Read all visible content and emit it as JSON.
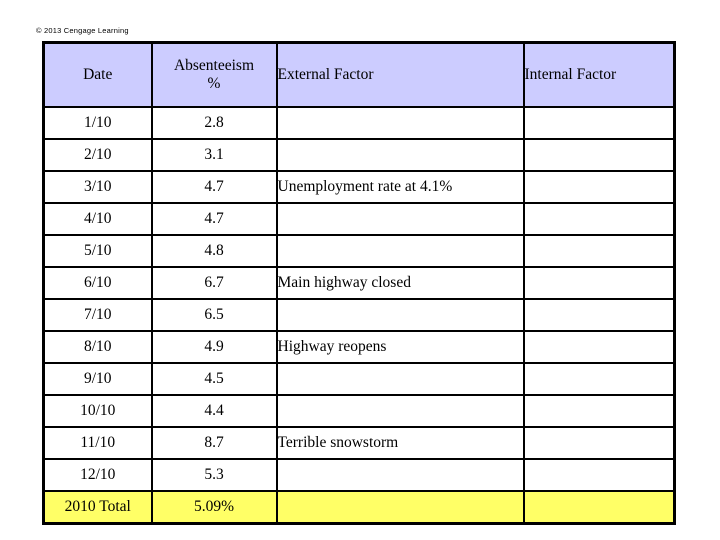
{
  "copyright": "© 2013 Cengage Learning",
  "table": {
    "columns": [
      {
        "key": "date",
        "label": "Date"
      },
      {
        "key": "pct",
        "label": "Absenteeism",
        "label_line2": "%"
      },
      {
        "key": "external",
        "label": "External Factor"
      },
      {
        "key": "internal",
        "label": "Internal Factor"
      }
    ],
    "header_bg": "#ccccff",
    "total_bg": "#ffff66",
    "rows": [
      {
        "date": "1/10",
        "pct": "2.8",
        "external": "",
        "internal": ""
      },
      {
        "date": "2/10",
        "pct": "3.1",
        "external": "",
        "internal": ""
      },
      {
        "date": "3/10",
        "pct": "4.7",
        "external": "Unemployment rate at 4.1%",
        "internal": ""
      },
      {
        "date": "4/10",
        "pct": "4.7",
        "external": "",
        "internal": ""
      },
      {
        "date": "5/10",
        "pct": "4.8",
        "external": "",
        "internal": ""
      },
      {
        "date": "6/10",
        "pct": "6.7",
        "external": "Main highway closed",
        "internal": ""
      },
      {
        "date": "7/10",
        "pct": "6.5",
        "external": "",
        "internal": ""
      },
      {
        "date": "8/10",
        "pct": "4.9",
        "external": "Highway reopens",
        "internal": ""
      },
      {
        "date": "9/10",
        "pct": "4.5",
        "external": "",
        "internal": ""
      },
      {
        "date": "10/10",
        "pct": "4.4",
        "external": "",
        "internal": ""
      },
      {
        "date": "11/10",
        "pct": "8.7",
        "external": "Terrible snowstorm",
        "internal": ""
      },
      {
        "date": "12/10",
        "pct": "5.3",
        "external": "",
        "internal": ""
      }
    ],
    "total_row": {
      "date": "2010 Total",
      "pct": "5.09%",
      "external": "",
      "internal": ""
    }
  }
}
